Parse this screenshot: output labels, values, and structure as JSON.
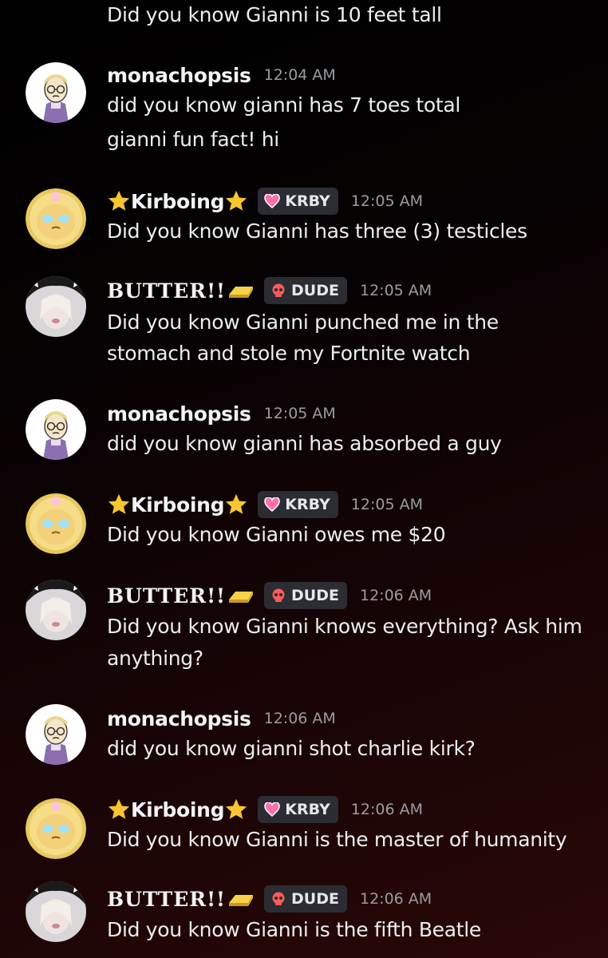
{
  "top_message": "Did you know Gianni is 10 feet tall",
  "users": {
    "monachopsis": {
      "name": "monachopsis"
    },
    "kirboing": {
      "name": "Kirboing",
      "tag": "KRBY"
    },
    "butter": {
      "name": "BUTTER!!",
      "tag": "DUDE"
    }
  },
  "messages": [
    {
      "user": "monachopsis",
      "time": "12:04 AM",
      "lines": [
        "did you know gianni has 7 toes total",
        "gianni fun fact!  hi"
      ]
    },
    {
      "user": "kirboing",
      "time": "12:05 AM",
      "lines": [
        "Did you know Gianni has three (3) testicles"
      ]
    },
    {
      "user": "butter",
      "time": "12:05 AM",
      "lines": [
        "Did you know Gianni punched me in the",
        "stomach and stole my Fortnite watch"
      ]
    },
    {
      "user": "monachopsis",
      "time": "12:05 AM",
      "lines": [
        "did you know gianni has absorbed a guy"
      ]
    },
    {
      "user": "kirboing",
      "time": "12:05 AM",
      "lines": [
        "Did you know Gianni owes me $20"
      ]
    },
    {
      "user": "butter",
      "time": "12:06 AM",
      "lines": [
        "Did you know Gianni knows everything? Ask him",
        "anything?"
      ]
    },
    {
      "user": "monachopsis",
      "time": "12:06 AM",
      "lines": [
        "did you know gianni shot charlie kirk?"
      ]
    },
    {
      "user": "kirboing",
      "time": "12:06 AM",
      "lines": [
        "Did you know Gianni is the master of humanity"
      ]
    },
    {
      "user": "butter",
      "time": "12:06 AM",
      "lines": [
        "Did you know Gianni is the fifth Beatle"
      ]
    }
  ],
  "colors": {
    "timestamp": "#9a9ca2",
    "tag_bg": "#2b2d33",
    "krby_icon": "#ff6fa8",
    "dude_icon": "#ff5a5a"
  }
}
